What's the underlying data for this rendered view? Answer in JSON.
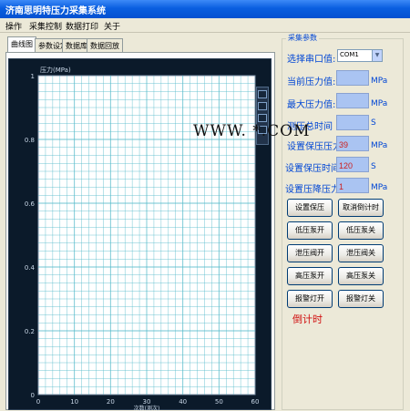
{
  "window": {
    "title": "济南思明特压力采集系统"
  },
  "menu": [
    "操作",
    "采集控制",
    "数据打印",
    "关于"
  ],
  "tabs": [
    "曲线图",
    "参数设定",
    "数据库",
    "数据回放"
  ],
  "group": {
    "title": "采集参数",
    "port_label": "选择串口值:",
    "port_value": "COM1",
    "fields": [
      {
        "label": "当前压力值:",
        "value": "",
        "unit": "MPa"
      },
      {
        "label": "最大压力值:",
        "value": "",
        "unit": "MPa"
      },
      {
        "label": "测压总时间",
        "value": "",
        "unit": "S"
      },
      {
        "label": "设置保压压力:",
        "value": "39",
        "unit": "MPa"
      },
      {
        "label": "设置保压时间:",
        "value": "120",
        "unit": "S"
      },
      {
        "label": "设置压降压力:",
        "value": "1",
        "unit": "MPa"
      }
    ],
    "buttons": [
      [
        "设置保压",
        "取消倒计时"
      ],
      [
        "低压泵开",
        "低压泵关"
      ],
      [
        "泄压阀开",
        "泄压阀关"
      ],
      [
        "高压泵开",
        "高压泵关"
      ],
      [
        "报警灯开",
        "报警灯关"
      ]
    ],
    "countdown_label": "倒计时"
  },
  "watermark": "WWW.  *.COM",
  "colors": {
    "chart_bg": "#0b1a2a",
    "plot_bg": "#ffffff",
    "grid": "#4fb8c8",
    "label": "#0046d5",
    "value_bg": "#aac4f2",
    "red_text": "#cc2020"
  },
  "chart_data": {
    "type": "line",
    "ylabel": "压力(MPa)",
    "xlabel": "次数(测次)",
    "xlim": [
      0,
      60
    ],
    "ylim": [
      0,
      1
    ],
    "x_ticks": [
      0,
      10,
      20,
      30,
      40,
      50,
      60
    ],
    "y_ticks": [
      "0",
      "0.2",
      "0.4",
      "0.6",
      "0.8",
      "1"
    ],
    "series": [],
    "grid": true
  }
}
